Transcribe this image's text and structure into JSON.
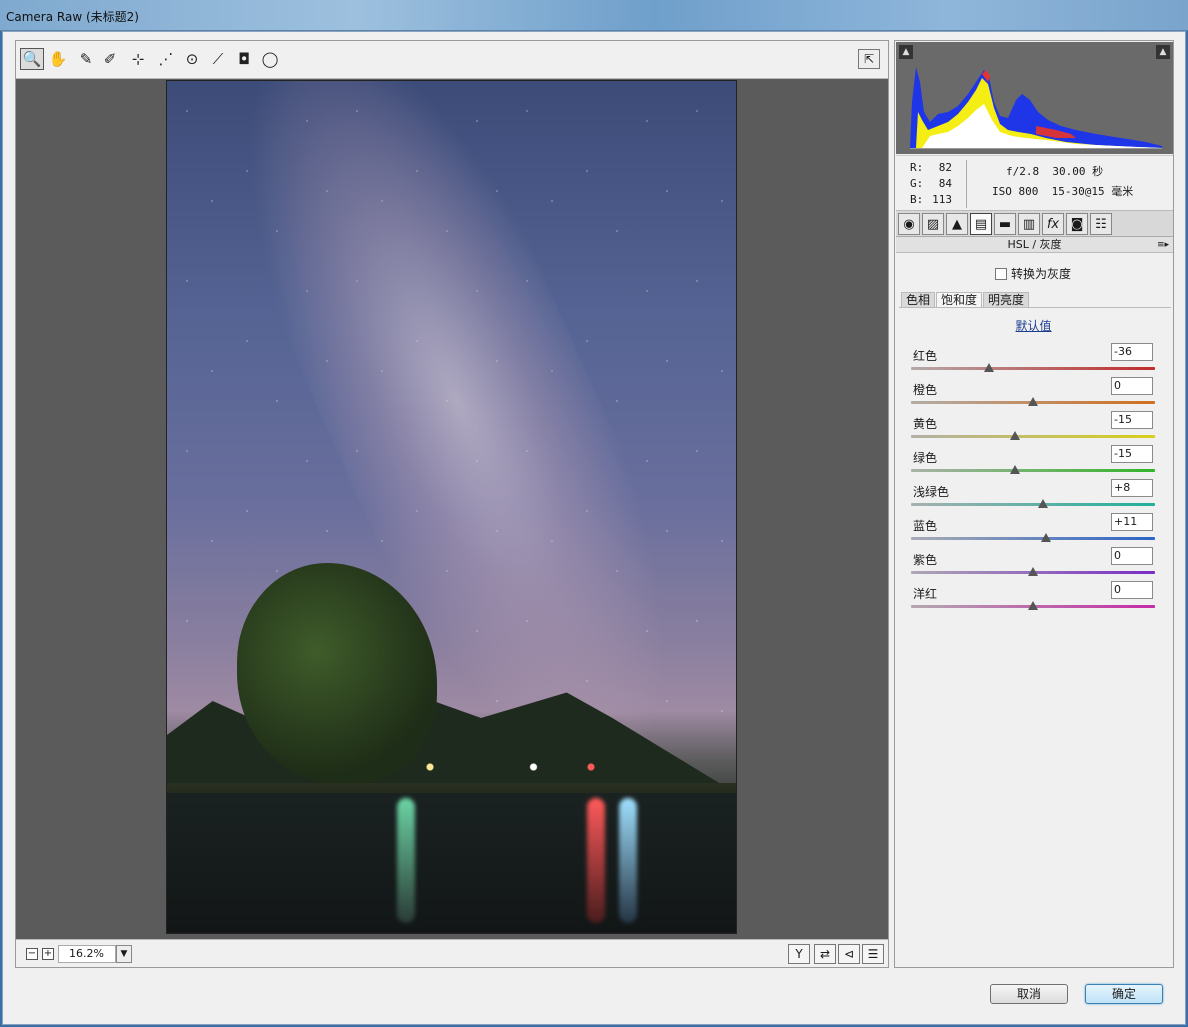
{
  "window": {
    "title": "Camera Raw (未标题2)"
  },
  "toolbar": {
    "tools": [
      {
        "name": "zoom-tool",
        "glyph": "🔍",
        "active": true
      },
      {
        "name": "hand-tool",
        "glyph": "✋"
      },
      {
        "name": "white-balance-tool",
        "glyph": "✎"
      },
      {
        "name": "color-sampler-tool",
        "glyph": "✐"
      },
      {
        "name": "targeted-adjustment-tool",
        "glyph": "⊹"
      },
      {
        "name": "spot-removal-tool",
        "glyph": "⋰"
      },
      {
        "name": "red-eye-tool",
        "glyph": "⊙"
      },
      {
        "name": "adjustment-brush-tool",
        "glyph": "⟋"
      },
      {
        "name": "graduated-filter-tool",
        "glyph": "◘"
      },
      {
        "name": "radial-filter-tool",
        "glyph": "◯"
      }
    ],
    "open_prefs_glyph": "⇱"
  },
  "status": {
    "zoom_minus": "−",
    "zoom_plus": "+",
    "zoom_value": "16.2%",
    "zoom_arrow": "▼"
  },
  "readout": {
    "r_label": "R:",
    "r_value": "82",
    "g_label": "G:",
    "g_value": "84",
    "b_label": "B:",
    "b_value": "113",
    "exif_line1": "f/2.8  30.00 秒",
    "exif_line2": "ISO 800  15-30@15 毫米"
  },
  "panel": {
    "section_title": "HSL / 灰度",
    "convert_gray_label": "转换为灰度",
    "subtabs": [
      "色相",
      "饱和度",
      "明亮度"
    ],
    "active_subtab": 1,
    "default_link": "默认值",
    "sliders": [
      {
        "label": "红色",
        "value": "-36",
        "num": -36,
        "track": "linear-gradient(90deg,#b5a9a9,#c02b2b)"
      },
      {
        "label": "橙色",
        "value": "0",
        "num": 0,
        "track": "linear-gradient(90deg,#b3aca6,#d06f1e)"
      },
      {
        "label": "黄色",
        "value": "-15",
        "num": -15,
        "track": "linear-gradient(90deg,#b2b0a6,#d8cf19)"
      },
      {
        "label": "绿色",
        "value": "-15",
        "num": -15,
        "track": "linear-gradient(90deg,#aab2a6,#32b52a)"
      },
      {
        "label": "浅绿色",
        "value": "+8",
        "num": 8,
        "track": "linear-gradient(90deg,#a6b1b0,#1fb09a)"
      },
      {
        "label": "蓝色",
        "value": "+11",
        "num": 11,
        "track": "linear-gradient(90deg,#a8abb4,#2b63c7)"
      },
      {
        "label": "紫色",
        "value": "0",
        "num": 0,
        "track": "linear-gradient(90deg,#aea8b4,#7a2dc6)"
      },
      {
        "label": "洋红",
        "value": "0",
        "num": 0,
        "track": "linear-gradient(90deg,#b3a8b1,#c62ba6)"
      }
    ]
  },
  "buttons": {
    "cancel": "取消",
    "ok": "确定"
  },
  "colors": {
    "accent": "#3c7fb1",
    "link": "#1d3d8f"
  }
}
